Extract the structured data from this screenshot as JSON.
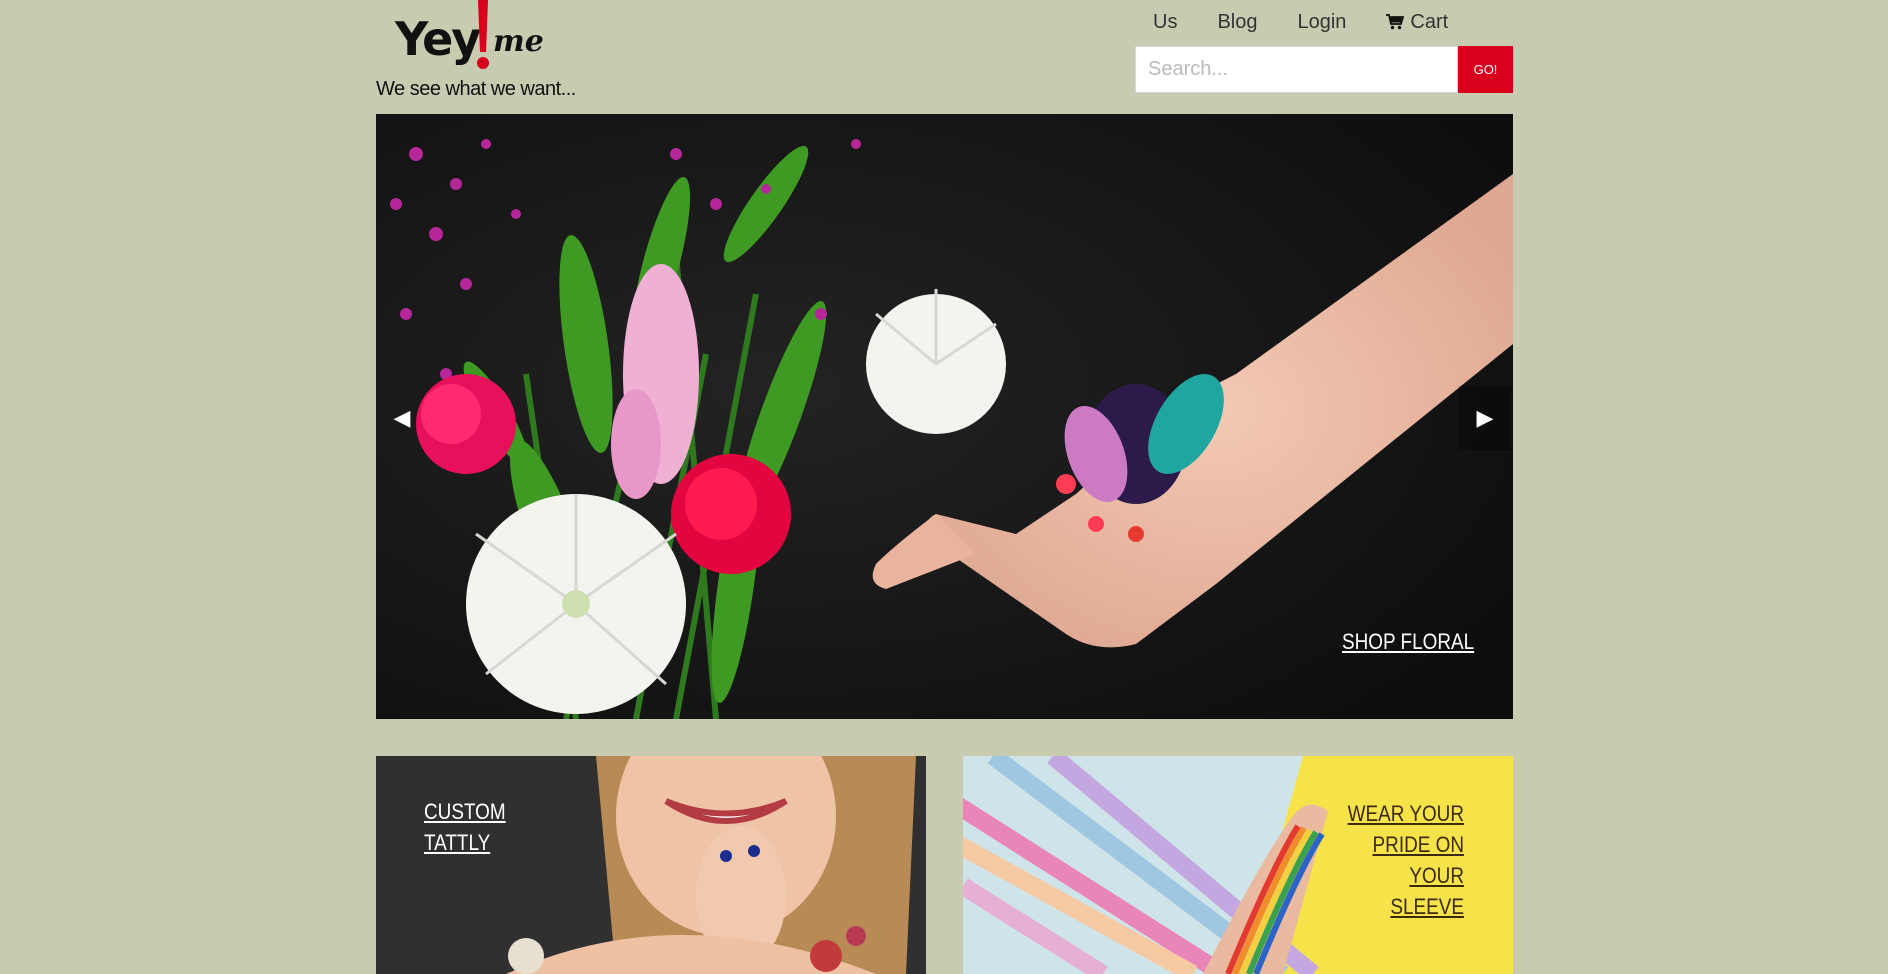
{
  "brand": {
    "logo_main": "Yey",
    "logo_suffix": "me",
    "tagline": "We see what we want..."
  },
  "nav": {
    "items": [
      {
        "label": "Us"
      },
      {
        "label": "Blog"
      },
      {
        "label": "Login"
      },
      {
        "label": "Cart",
        "icon": "cart-icon"
      }
    ]
  },
  "search": {
    "placeholder": "Search...",
    "button_label": "GO!"
  },
  "hero": {
    "prev_arrow": "◀",
    "next_arrow": "▶",
    "link_label": "SHOP FLORAL"
  },
  "tiles": [
    {
      "line1": "CUSTOM",
      "line2": "TATTLY"
    },
    {
      "line1": "WEAR YOUR",
      "line2": "PRIDE ON",
      "line3": "YOUR SLEEVE"
    }
  ],
  "colors": {
    "background": "#c8cbb0",
    "accent": "#d9001b",
    "hero_bg": "#141414"
  }
}
